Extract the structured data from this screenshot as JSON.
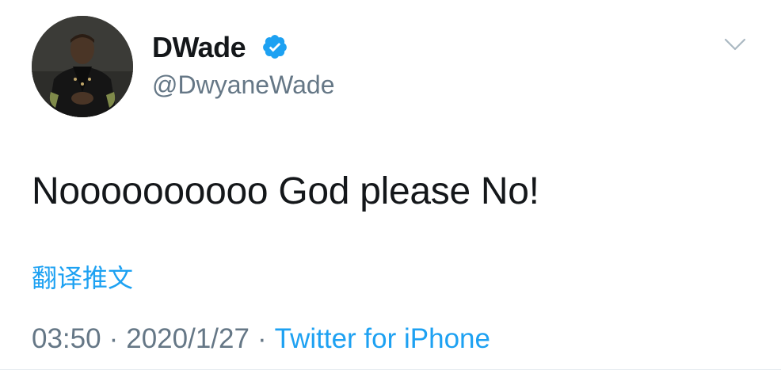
{
  "user": {
    "display_name": "DWade",
    "handle": "@DwyaneWade",
    "verified": true
  },
  "tweet": {
    "text": "Noooooooooo God please No!",
    "translate_label": "翻译推文",
    "time": "03:50",
    "separator": "·",
    "date": "2020/1/27",
    "source": "Twitter for iPhone"
  },
  "icons": {
    "verified": "verified-badge-icon",
    "menu": "chevron-down-icon"
  },
  "colors": {
    "link": "#1da1f2",
    "secondary_text": "#657786",
    "primary_text": "#14171a",
    "verified_badge": "#1da1f2"
  }
}
